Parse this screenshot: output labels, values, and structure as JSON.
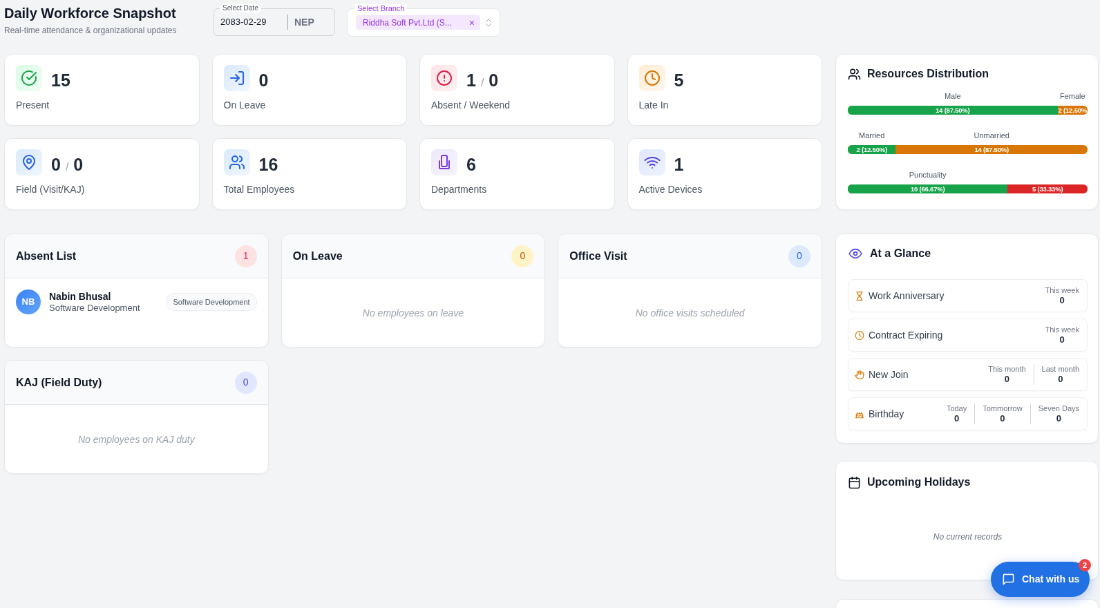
{
  "header": {
    "title": "Daily Workforce Snapshot",
    "subtitle": "Real-time attendance & organizational updates"
  },
  "date_field": {
    "label": "Select Date",
    "value": "2083-02-29",
    "calendar": "NEP"
  },
  "branch_select": {
    "label": "Select Branch",
    "chips": [
      {
        "text": "Riddha Soft Pvt.Ltd (S...",
        "remove": "×"
      }
    ]
  },
  "stats": [
    {
      "kind": "present",
      "value": "15",
      "label": "Present"
    },
    {
      "kind": "leave",
      "value": "0",
      "label": "On Leave"
    },
    {
      "kind": "absent",
      "value": "1",
      "divider": "/",
      "value_2": "0",
      "label": "Absent / Weekend"
    },
    {
      "kind": "late",
      "value": "5",
      "label": "Late In"
    },
    {
      "kind": "field",
      "value": "0",
      "divider": "/",
      "value_2": "0",
      "label": "Field (Visit/KAJ)"
    },
    {
      "kind": "employees",
      "value": "16",
      "label": "Total Employees"
    },
    {
      "kind": "departments",
      "value": "6",
      "label": "Departments"
    },
    {
      "kind": "devices",
      "value": "1",
      "label": "Active Devices"
    }
  ],
  "resources": {
    "title": "Resources Distribution",
    "bars": [
      {
        "level": 0.875,
        "segments": [
          {
            "label": "Male",
            "text": "14 (87.50%)",
            "color": "#16a34a"
          },
          {
            "label": "Female",
            "text": "2 (12.50%",
            "color": "#d97706"
          }
        ]
      },
      {
        "level": 0.2,
        "segments": [
          {
            "label": "Married",
            "text": "2 (12.50%)",
            "color": "#16a34a"
          },
          {
            "label": "Unmarried",
            "text": "14 (87.50%)",
            "color": "#d97706"
          }
        ]
      },
      {
        "level": 0.6667,
        "segments": [
          {
            "label": "Punctuality",
            "text": "10 (66.67%)",
            "color": "#16a34a"
          },
          {
            "text": "5 (33.33%)",
            "color": "#dc2626"
          }
        ]
      }
    ]
  },
  "lists": [
    {
      "kind": "absent",
      "title": "Absent List",
      "count": "1",
      "employees": [
        {
          "initials": "NB",
          "name": "Nabin Bhusal",
          "department": "Software Development",
          "tag": "Software Development"
        }
      ]
    },
    {
      "kind": "leave",
      "title": "On Leave",
      "count": "0",
      "empty_text": "No employees on leave"
    },
    {
      "kind": "visit",
      "title": "Office Visit",
      "count": "0",
      "empty_text": "No office visits scheduled"
    },
    {
      "kind": "field",
      "title": "KAJ (Field Duty)",
      "count": "0",
      "empty_text": "No employees on KAJ duty"
    }
  ],
  "glance": {
    "title": "At a Glance",
    "rows": [
      {
        "kind": "anniversary",
        "label": "Work Anniversary",
        "periods": [
          {
            "label": "This week",
            "value": "0"
          }
        ]
      },
      {
        "kind": "contract",
        "label": "Contract Expiring",
        "periods": [
          {
            "label": "This week",
            "value": "0"
          }
        ]
      },
      {
        "kind": "join",
        "label": "New Join",
        "periods": [
          {
            "label": "This month",
            "value": "0"
          },
          {
            "label": "Last month",
            "value": "0"
          }
        ]
      },
      {
        "kind": "birthday",
        "label": "Birthday",
        "periods": [
          {
            "label": "Today",
            "value": "0"
          },
          {
            "label": "Tommorrow",
            "value": "0"
          },
          {
            "label": "Seven Days",
            "value": "0"
          }
        ]
      }
    ]
  },
  "holidays": {
    "title": "Upcoming Holidays",
    "empty_text": "No current records"
  },
  "chat": {
    "label": "Chat with us",
    "badge": "2"
  }
}
